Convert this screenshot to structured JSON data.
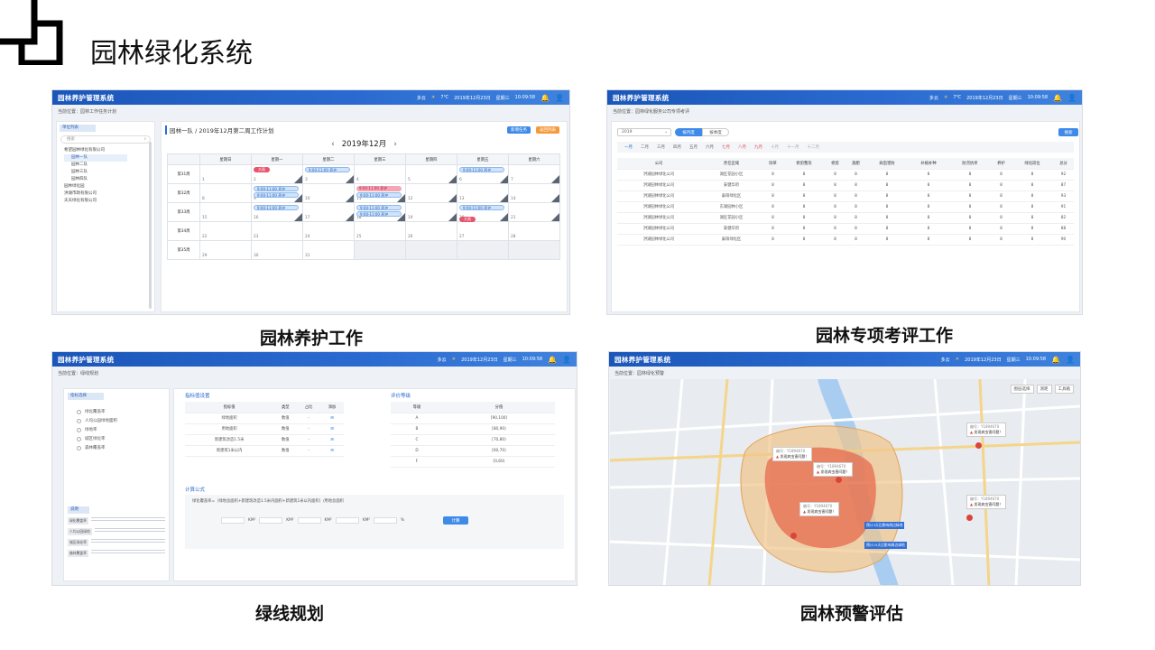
{
  "slide": {
    "title": "园林绿化系统"
  },
  "app": {
    "name": "园林养护管理系统",
    "weather": "多云",
    "temp": "7℃",
    "date": "2019年12月23日",
    "weekday": "星期三",
    "time": "10:09:58"
  },
  "panel1": {
    "caption": "园林养护工作",
    "breadcrumb": "当前位置：园林工作任务计划",
    "sidebar_title": "单位列表",
    "search_placeholder": "搜索",
    "tree": [
      "希望园林绿化有限公司",
      "园林一队",
      "园林二队",
      "园林三队",
      "园林四队",
      "园林绿化园",
      "洪湖市政有限公司",
      "天天绿化有限公司"
    ],
    "plan_title": "园林一队 / 2019年12月第二周工作计划",
    "month": "2019年12月",
    "btn_primary": "新增任务",
    "btn_secondary": "返回列表",
    "weekdays": [
      "星期日",
      "星期一",
      "星期二",
      "星期三",
      "星期四",
      "星期五",
      "星期六"
    ],
    "weeks": [
      {
        "label": "第31周",
        "days": [
          "1",
          "2",
          "3",
          "4",
          "5",
          "6",
          "7"
        ]
      },
      {
        "label": "第32周",
        "days": [
          "8",
          "9",
          "10",
          "11",
          "12",
          "13",
          "14"
        ]
      },
      {
        "label": "第33周",
        "days": [
          "15",
          "16",
          "17",
          "18",
          "19",
          "20",
          "21"
        ]
      },
      {
        "label": "第34周",
        "days": [
          "22",
          "23",
          "24",
          "25",
          "26",
          "27",
          "28"
        ]
      },
      {
        "label": "第35周",
        "days": [
          "29",
          "30",
          "31",
          "",
          "",
          "",
          ""
        ]
      }
    ],
    "events": {
      "tag": "大雨",
      "slot": "9:00-11:00 养护"
    }
  },
  "panel2": {
    "caption": "园林专项考评工作",
    "breadcrumb": "当前位置：园林绿化服务公司专项考评",
    "year": "2019",
    "tab_on": "按月度",
    "tab_off": "按季度",
    "btn": "搜索",
    "months": [
      "一月",
      "二月",
      "三月",
      "四月",
      "五月",
      "六月",
      "七月",
      "八月",
      "九月",
      "十月",
      "十一月",
      "十二月"
    ],
    "headers": [
      "公司",
      "责任区域",
      "除草",
      "修剪整形",
      "修剪",
      "施肥",
      "病虫害防",
      "补植补种",
      "防涝抗旱",
      "养护",
      "绿化岗位",
      "总分"
    ],
    "rows": [
      [
        "洪湖园林绿化公司",
        "湖区花园小区",
        "8",
        "8",
        "8",
        "8",
        "8",
        "8",
        "8",
        "8",
        "8",
        "92"
      ],
      [
        "洪湖园林绿化公司",
        "安健华府",
        "8",
        "8",
        "8",
        "8",
        "8",
        "8",
        "8",
        "8",
        "8",
        "87"
      ],
      [
        "洪湖园林绿化公司",
        "泰阳绿化区",
        "8",
        "8",
        "8",
        "8",
        "8",
        "8",
        "8",
        "8",
        "8",
        "93"
      ],
      [
        "洪湖园林绿化公司",
        "东湖园林小区",
        "8",
        "8",
        "8",
        "8",
        "8",
        "8",
        "8",
        "8",
        "8",
        "91"
      ],
      [
        "洪湖园林绿化公司",
        "湖区花园小区",
        "8",
        "8",
        "8",
        "8",
        "8",
        "8",
        "8",
        "8",
        "8",
        "82"
      ],
      [
        "洪湖园林绿化公司",
        "安健华府",
        "8",
        "8",
        "8",
        "8",
        "8",
        "8",
        "8",
        "8",
        "8",
        "88"
      ],
      [
        "洪湖园林绿化公司",
        "泰阳绿化区",
        "8",
        "8",
        "8",
        "8",
        "8",
        "8",
        "8",
        "8",
        "8",
        "90"
      ]
    ]
  },
  "panel3": {
    "caption": "绿线规划",
    "breadcrumb": "当前位置：绿线规划",
    "left_title": "指标选择",
    "options": [
      "绿化覆盖率",
      "人均公园绿地面积",
      "绿地率",
      "城区绿化率",
      "森林覆盖率"
    ],
    "note_title": "说明",
    "notes": [
      "绿化覆盖率",
      "人均公园绿地",
      "城区绿化率",
      "森林覆盖率"
    ],
    "indicator_title": "指标值设置",
    "ind_headers": [
      "指标值",
      "类型",
      "占比",
      "添加"
    ],
    "ind_rows": [
      [
        "绿地面积",
        "数值",
        "-"
      ],
      [
        "用地面积",
        "数值",
        "-"
      ],
      [
        "新建筑改造1.5米",
        "数值",
        "-"
      ],
      [
        "新建筑1米以内",
        "数值",
        "-"
      ]
    ],
    "grade_title": "评价等级",
    "grade_headers": [
      "等级",
      "分值"
    ],
    "grades": [
      [
        "A",
        "[90,100]"
      ],
      [
        "B",
        "[80,90)"
      ],
      [
        "C",
        "[70,80)"
      ],
      [
        "D",
        "[60,70)"
      ],
      [
        "F",
        "[0,60)"
      ]
    ],
    "formula_title": "计算公式",
    "formula": "绿化覆盖率=（绿地总面积+新建筑改造1.5米内面积+新建筑1米以内面积）/用地总面积",
    "calc_btn": "计算",
    "units": [
      "KM²",
      "KM²",
      "KM²",
      "KM²",
      "%"
    ]
  },
  "panel4": {
    "caption": "园林预警评估",
    "breadcrumb": "当前位置：园林绿化预警",
    "alert_text": "发现病虫害问题！",
    "alert_id": "编号：Y1894670",
    "tags": [
      "预计3天后影响周边绿地",
      "预计15天后影响周边绿地"
    ],
    "map_tools": [
      "图层选择",
      "测距",
      "工具箱"
    ]
  },
  "colors": {
    "brand": "#1b56b9",
    "accent_orange": "#f39a3b",
    "alert_red": "#d9453b"
  }
}
